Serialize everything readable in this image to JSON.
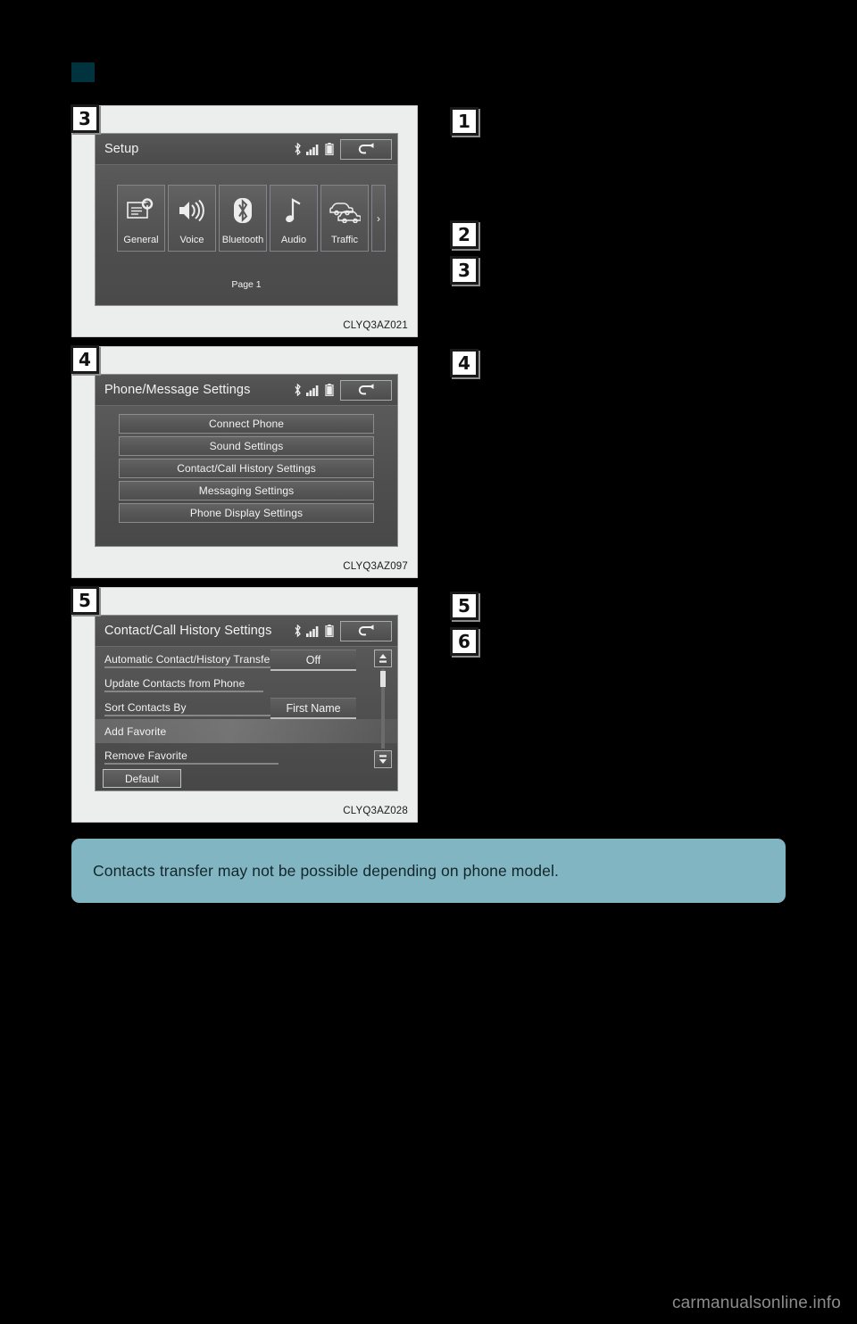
{
  "page": {
    "section_marker_color": "#00333d",
    "background_color": "#000000",
    "footer_watermark": "carmanualsonline.info"
  },
  "instruction_steps": [
    {
      "number": "1",
      "text": ""
    },
    {
      "number": "2",
      "text": ""
    },
    {
      "number": "3",
      "text": ""
    },
    {
      "number": "4",
      "text": ""
    },
    {
      "number": "5",
      "text": ""
    },
    {
      "number": "6",
      "text": ""
    }
  ],
  "figures": [
    {
      "step_chip": "3",
      "image_code": "CLYQ3AZ021",
      "screen": {
        "title": "Setup",
        "status_icons": [
          "bluetooth-icon",
          "signal-icon",
          "battery-icon"
        ],
        "back_button": "back-arrow-icon",
        "tiles": [
          {
            "label": "General",
            "icon": "general-document-gear-icon"
          },
          {
            "label": "Voice",
            "icon": "voice-speaker-icon"
          },
          {
            "label": "Bluetooth",
            "icon": "bluetooth-icon"
          },
          {
            "label": "Audio",
            "icon": "audio-music-note-icon"
          },
          {
            "label": "Traffic",
            "icon": "traffic-cars-icon"
          }
        ],
        "next_page_arrow": "›",
        "page_label": "Page 1"
      }
    },
    {
      "step_chip": "4",
      "image_code": "CLYQ3AZ097",
      "screen": {
        "title": "Phone/Message Settings",
        "status_icons": [
          "bluetooth-icon",
          "signal-icon",
          "battery-icon"
        ],
        "back_button": "back-arrow-icon",
        "buttons": [
          "Connect Phone",
          "Sound Settings",
          "Contact/Call History Settings",
          "Messaging Settings",
          "Phone Display Settings"
        ]
      }
    },
    {
      "step_chip": "5",
      "image_code": "CLYQ3AZ028",
      "screen": {
        "title": "Contact/Call History Settings",
        "status_icons": [
          "bluetooth-icon",
          "signal-icon",
          "battery-icon"
        ],
        "back_button": "back-arrow-icon",
        "rows": [
          {
            "label": "Automatic Contact/History Transfer",
            "value": "Off",
            "highlighted": false
          },
          {
            "label": "Update Contacts from Phone",
            "value": "",
            "highlighted": false
          },
          {
            "label": "Sort Contacts By",
            "value": "First Name",
            "highlighted": false
          },
          {
            "label": "Add Favorite",
            "value": "",
            "highlighted": true
          },
          {
            "label": "Remove Favorite",
            "value": "",
            "highlighted": false
          }
        ],
        "default_button": "Default",
        "scroll_up_icon": "scroll-up-icon",
        "scroll_down_icon": "scroll-down-icon"
      }
    }
  ],
  "note": {
    "text": "Contacts transfer may not be possible depending on phone model.",
    "background_color": "#80b5c1",
    "text_color": "#14262b"
  }
}
